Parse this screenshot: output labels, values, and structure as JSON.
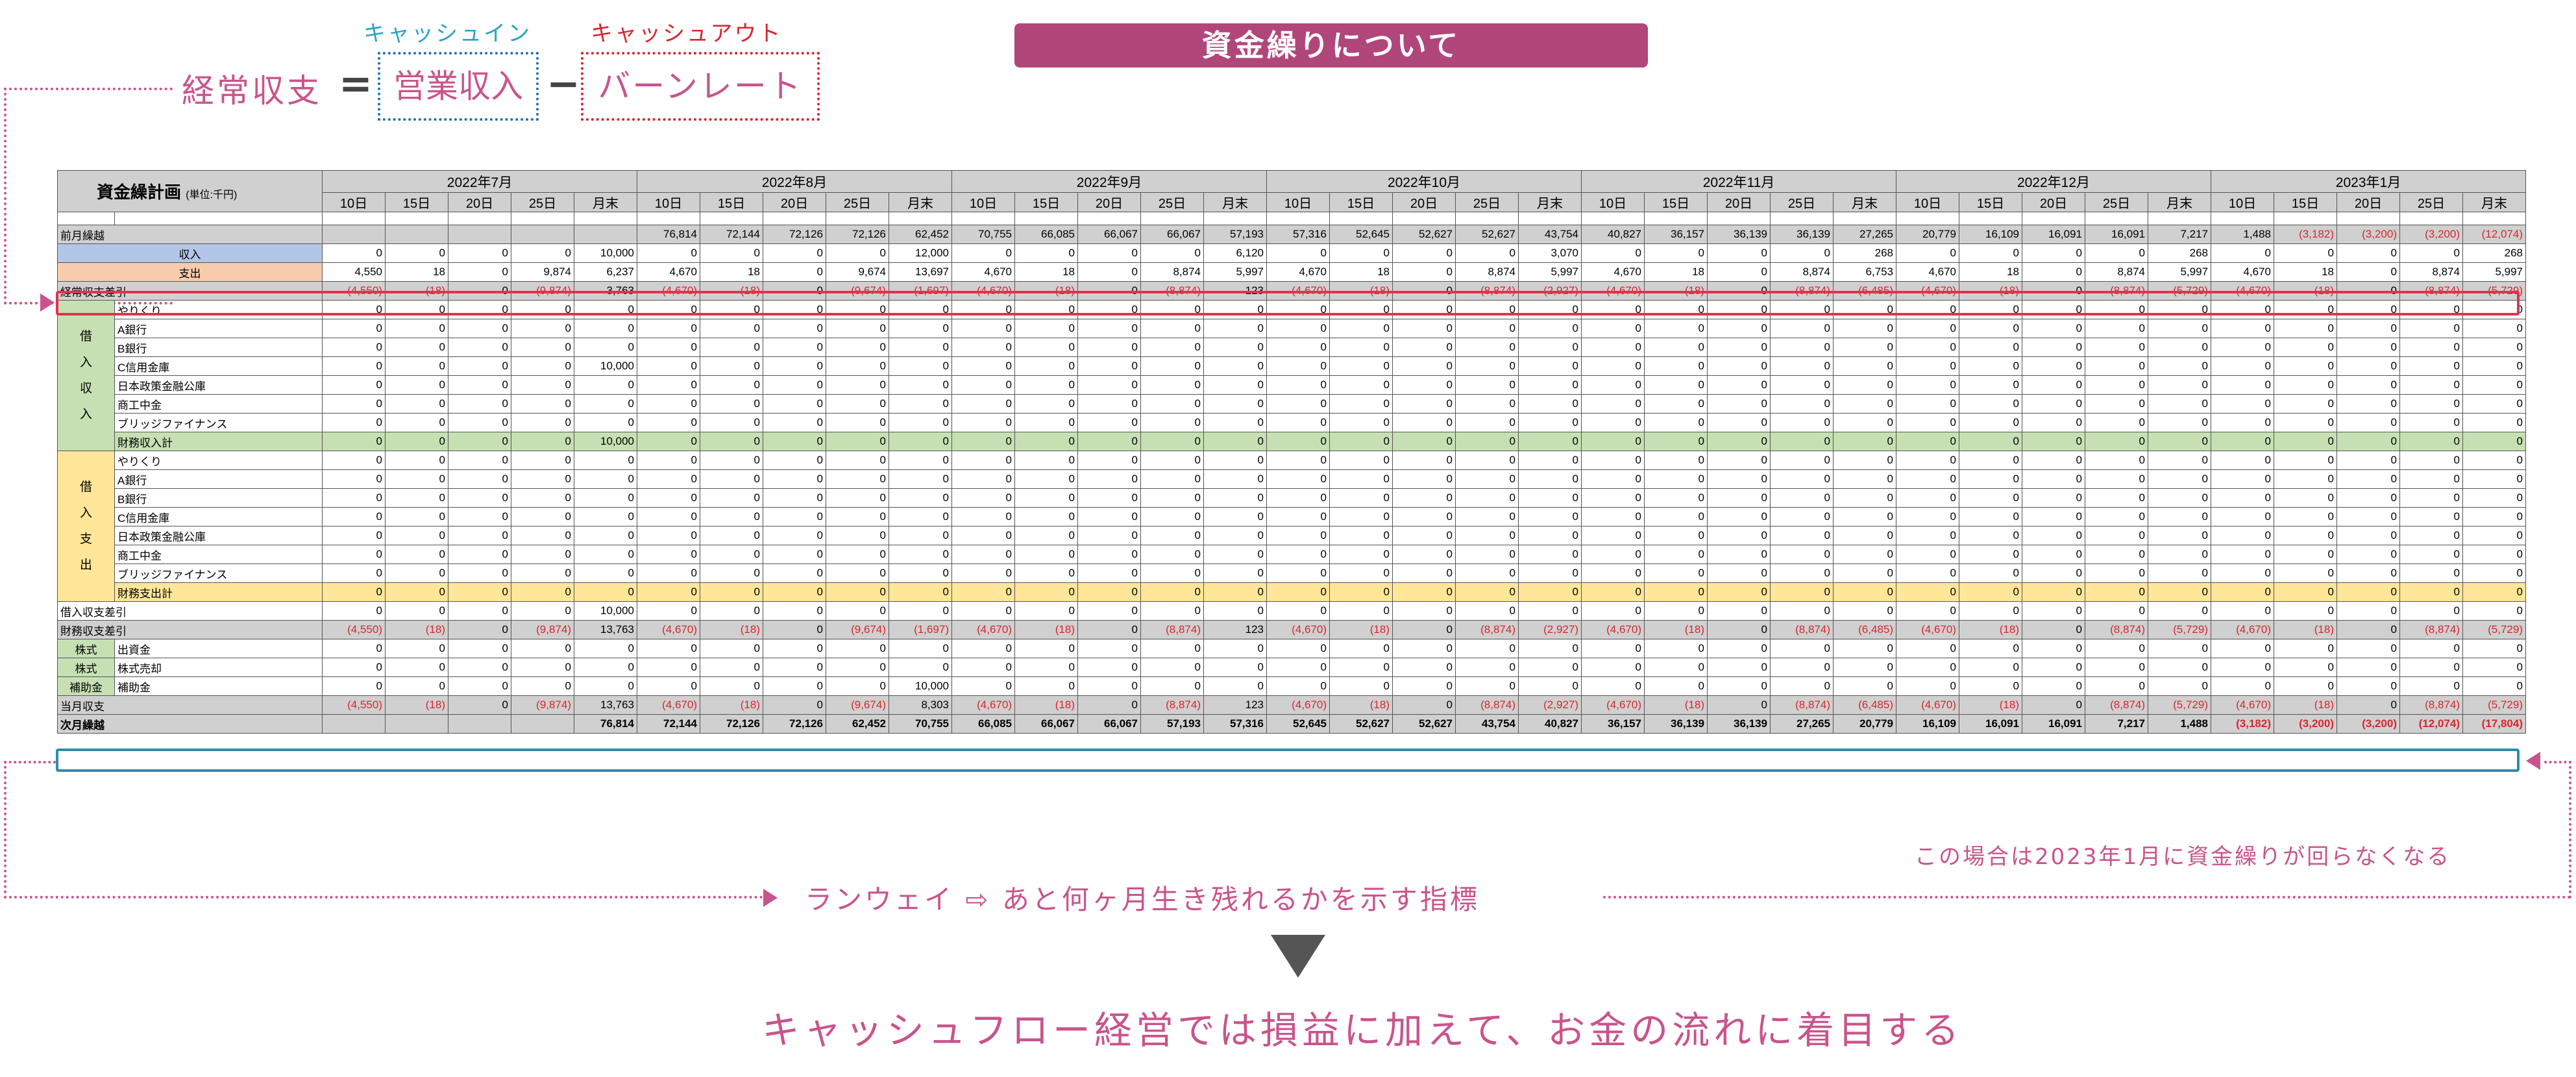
{
  "page_title": "資金繰りについて",
  "formula": {
    "label": "経常収支",
    "equals": "=",
    "minus": "−",
    "cash_in_caption": "キャッシュイン",
    "cash_out_caption": "キャッシュアウト",
    "cash_in_term": "営業収入",
    "cash_out_term": "バーンレート"
  },
  "table": {
    "title": "資金繰計画",
    "unit": "(単位:千円)",
    "months": [
      "2022年7月",
      "2022年8月",
      "2022年9月",
      "2022年10月",
      "2022年11月",
      "2022年12月",
      "2023年1月"
    ],
    "days": [
      "10日",
      "15日",
      "20日",
      "25日",
      "月末"
    ],
    "side_labels": {
      "borrow_in": "借入収入",
      "borrow_out": "借入支出",
      "stock": "株式",
      "subsidy": "補助金"
    },
    "rows": [
      {
        "label": "前月繰越",
        "style": "gray",
        "values": [
          "",
          "",
          "",
          "",
          "",
          "76,814",
          "72,144",
          "72,126",
          "72,126",
          "62,452",
          "70,755",
          "66,085",
          "66,067",
          "66,067",
          "57,193",
          "57,316",
          "52,645",
          "52,627",
          "52,627",
          "43,754",
          "40,827",
          "36,157",
          "36,139",
          "36,139",
          "27,265",
          "20,779",
          "16,109",
          "16,091",
          "16,091",
          "7,217",
          "1,488",
          "(3,182)",
          "(3,200)",
          "(3,200)",
          "(12,074)"
        ]
      },
      {
        "label": "収入",
        "style": "blue",
        "values": [
          "0",
          "0",
          "0",
          "0",
          "10,000",
          "0",
          "0",
          "0",
          "0",
          "12,000",
          "0",
          "0",
          "0",
          "0",
          "6,120",
          "0",
          "0",
          "0",
          "0",
          "3,070",
          "0",
          "0",
          "0",
          "0",
          "268",
          "0",
          "0",
          "0",
          "0",
          "268",
          "0",
          "0",
          "0",
          "0",
          "268"
        ]
      },
      {
        "label": "支出",
        "style": "pink",
        "values": [
          "4,550",
          "18",
          "0",
          "9,874",
          "6,237",
          "4,670",
          "18",
          "0",
          "9,674",
          "13,697",
          "4,670",
          "18",
          "0",
          "8,874",
          "5,997",
          "4,670",
          "18",
          "0",
          "8,874",
          "5,997",
          "4,670",
          "18",
          "0",
          "8,874",
          "6,753",
          "4,670",
          "18",
          "0",
          "8,874",
          "5,997",
          "4,670",
          "18",
          "0",
          "8,874",
          "5,997"
        ]
      },
      {
        "label": "経常収支差引",
        "style": "gray",
        "values": [
          "(4,550)",
          "(18)",
          "0",
          "(9,874)",
          "3,763",
          "(4,670)",
          "(18)",
          "0",
          "(9,674)",
          "(1,697)",
          "(4,670)",
          "(18)",
          "0",
          "(8,874)",
          "123",
          "(4,670)",
          "(18)",
          "0",
          "(8,874)",
          "(2,927)",
          "(4,670)",
          "(18)",
          "0",
          "(8,874)",
          "(6,485)",
          "(4,670)",
          "(18)",
          "0",
          "(8,874)",
          "(5,729)",
          "(4,670)",
          "(18)",
          "0",
          "(8,874)",
          "(5,729)"
        ]
      },
      {
        "label": "やりくり",
        "group": "in",
        "values": "zero"
      },
      {
        "label": "A銀行",
        "group": "in",
        "values": "zero"
      },
      {
        "label": "B銀行",
        "group": "in",
        "values": "zero"
      },
      {
        "label": "C信用金庫",
        "group": "in",
        "values": [
          "0",
          "0",
          "0",
          "0",
          "10,000",
          "0",
          "0",
          "0",
          "0",
          "0",
          "0",
          "0",
          "0",
          "0",
          "0",
          "0",
          "0",
          "0",
          "0",
          "0",
          "0",
          "0",
          "0",
          "0",
          "0",
          "0",
          "0",
          "0",
          "0",
          "0",
          "0",
          "0",
          "0",
          "0",
          "0"
        ]
      },
      {
        "label": "日本政策金融公庫",
        "group": "in",
        "values": "zero"
      },
      {
        "label": "商工中金",
        "group": "in",
        "values": "zero"
      },
      {
        "label": "ブリッジファイナンス",
        "group": "in",
        "values": "zero"
      },
      {
        "label": "財務収入計",
        "group": "in",
        "style": "green",
        "values": [
          "0",
          "0",
          "0",
          "0",
          "10,000",
          "0",
          "0",
          "0",
          "0",
          "0",
          "0",
          "0",
          "0",
          "0",
          "0",
          "0",
          "0",
          "0",
          "0",
          "0",
          "0",
          "0",
          "0",
          "0",
          "0",
          "0",
          "0",
          "0",
          "0",
          "0",
          "0",
          "0",
          "0",
          "0",
          "0"
        ]
      },
      {
        "label": "やりくり",
        "group": "out",
        "values": "zero"
      },
      {
        "label": "A銀行",
        "group": "out",
        "values": "zero"
      },
      {
        "label": "B銀行",
        "group": "out",
        "values": "zero"
      },
      {
        "label": "C信用金庫",
        "group": "out",
        "values": "zero"
      },
      {
        "label": "日本政策金融公庫",
        "group": "out",
        "values": "zero"
      },
      {
        "label": "商工中金",
        "group": "out",
        "values": "zero"
      },
      {
        "label": "ブリッジファイナンス",
        "group": "out",
        "values": "zero"
      },
      {
        "label": "財務支出計",
        "group": "out",
        "style": "yellow",
        "values": "zero"
      },
      {
        "label": "借入収支差引",
        "values": [
          "0",
          "0",
          "0",
          "0",
          "10,000",
          "0",
          "0",
          "0",
          "0",
          "0",
          "0",
          "0",
          "0",
          "0",
          "0",
          "0",
          "0",
          "0",
          "0",
          "0",
          "0",
          "0",
          "0",
          "0",
          "0",
          "0",
          "0",
          "0",
          "0",
          "0",
          "0",
          "0",
          "0",
          "0",
          "0"
        ]
      },
      {
        "label": "財務収支差引",
        "style": "gray",
        "values": [
          "(4,550)",
          "(18)",
          "0",
          "(9,874)",
          "13,763",
          "(4,670)",
          "(18)",
          "0",
          "(9,674)",
          "(1,697)",
          "(4,670)",
          "(18)",
          "0",
          "(8,874)",
          "123",
          "(4,670)",
          "(18)",
          "0",
          "(8,874)",
          "(2,927)",
          "(4,670)",
          "(18)",
          "0",
          "(8,874)",
          "(6,485)",
          "(4,670)",
          "(18)",
          "0",
          "(8,874)",
          "(5,729)",
          "(4,670)",
          "(18)",
          "0",
          "(8,874)",
          "(5,729)"
        ]
      },
      {
        "label": "出資金",
        "group": "stock",
        "values": "zero"
      },
      {
        "label": "株式売却",
        "group": "stock",
        "values": "zero"
      },
      {
        "label": "補助金",
        "group": "subsidy",
        "values": [
          "0",
          "0",
          "0",
          "0",
          "0",
          "0",
          "0",
          "0",
          "0",
          "10,000",
          "0",
          "0",
          "0",
          "0",
          "0",
          "0",
          "0",
          "0",
          "0",
          "0",
          "0",
          "0",
          "0",
          "0",
          "0",
          "0",
          "0",
          "0",
          "0",
          "0",
          "0",
          "0",
          "0",
          "0",
          "0"
        ]
      },
      {
        "label": "当月収支",
        "style": "gray",
        "values": [
          "(4,550)",
          "(18)",
          "0",
          "(9,874)",
          "13,763",
          "(4,670)",
          "(18)",
          "0",
          "(9,674)",
          "8,303",
          "(4,670)",
          "(18)",
          "0",
          "(8,874)",
          "123",
          "(4,670)",
          "(18)",
          "0",
          "(8,874)",
          "(2,927)",
          "(4,670)",
          "(18)",
          "0",
          "(8,874)",
          "(6,485)",
          "(4,670)",
          "(18)",
          "0",
          "(8,874)",
          "(5,729)",
          "(4,670)",
          "(18)",
          "0",
          "(8,874)",
          "(5,729)"
        ]
      },
      {
        "label": "次月繰越",
        "style": "gray",
        "bold": true,
        "values": [
          "",
          "",
          "",
          "",
          "76,814",
          "72,144",
          "72,126",
          "72,126",
          "62,452",
          "70,755",
          "66,085",
          "66,067",
          "66,067",
          "57,193",
          "57,316",
          "52,645",
          "52,627",
          "52,627",
          "43,754",
          "40,827",
          "36,157",
          "36,139",
          "36,139",
          "27,265",
          "20,779",
          "16,109",
          "16,091",
          "16,091",
          "7,217",
          "1,488",
          "(3,182)",
          "(3,200)",
          "(3,200)",
          "(12,074)",
          "(17,804)"
        ]
      }
    ]
  },
  "note_right": "この場合は2023年1月に資金繰りが回らなくなる",
  "runway_text": "ランウェイ ⇨ あと何ヶ月生き残れるかを示す指標",
  "bottom_text": "キャッシュフロー経営では損益に加えて、お金の流れに着目する",
  "colors": {
    "accent": "#b1467a",
    "pink": "#c9548c",
    "red": "#d9262e",
    "cyan": "#2aa3c8",
    "blue_box": "#1d72b8",
    "highlight_red": "#e0334f",
    "highlight_blue": "#2a8ea8"
  }
}
